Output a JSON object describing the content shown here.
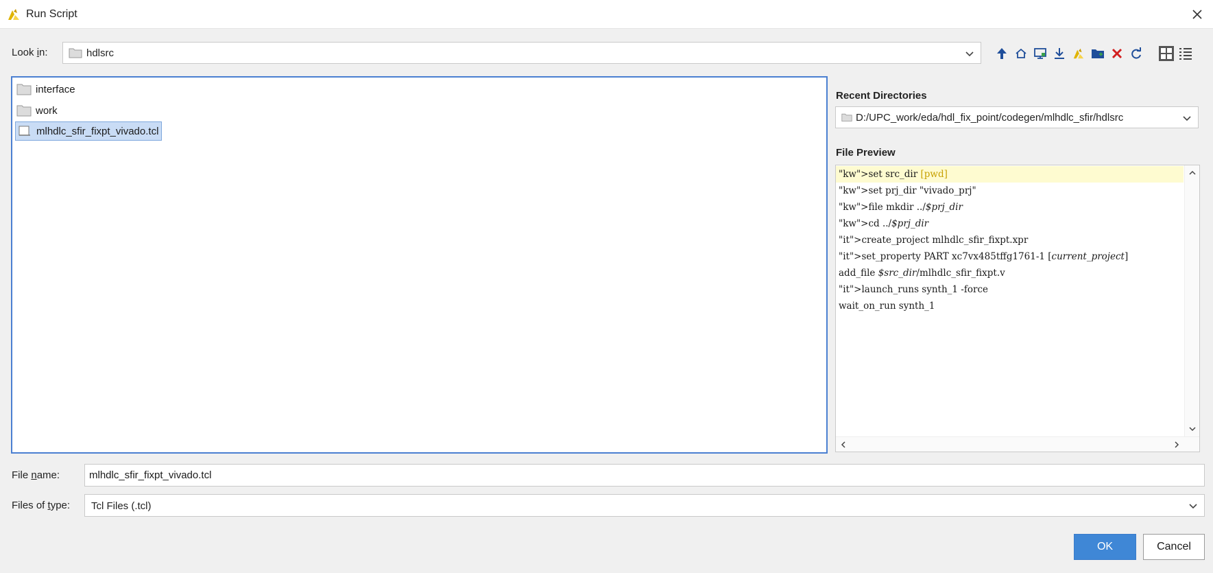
{
  "window": {
    "title": "Run Script"
  },
  "look_in": {
    "label_pre": "Look ",
    "label_mnemonic": "i",
    "label_post": "n:",
    "value": "hdlsrc"
  },
  "toolbar": {
    "icons": [
      "arrow-up-icon",
      "home-icon",
      "desktop-icon",
      "download-icon",
      "vivado-project-icon",
      "new-folder-icon",
      "delete-icon",
      "refresh-icon",
      "grid-view-icon",
      "list-view-icon"
    ]
  },
  "files": [
    {
      "name": "interface",
      "type": "folder"
    },
    {
      "name": "work",
      "type": "folder"
    },
    {
      "name": "mlhdlc_sfir_fixpt_vivado.tcl",
      "type": "file",
      "selected": true
    }
  ],
  "recent_directories": {
    "title": "Recent Directories",
    "value": "D:/UPC_work/eda/hdl_fix_point/codegen/mlhdlc_sfir/hdlsrc"
  },
  "file_preview": {
    "title": "File Preview",
    "lines": [
      "set src_dir [pwd]",
      "set prj_dir \"vivado_prj\"",
      "file mkdir ../$prj_dir",
      "cd ../$prj_dir",
      "create_project mlhdlc_sfir_fixpt.xpr",
      "set_property PART xc7vx485tffg1761-1 [current_project]",
      "add_file $src_dir/mlhdlc_sfir_fixpt.v",
      "launch_runs synth_1 -force",
      "wait_on_run synth_1"
    ]
  },
  "file_name": {
    "label_pre": "File ",
    "label_mnemonic": "n",
    "label_post": "ame:",
    "value": "mlhdlc_sfir_fixpt_vivado.tcl"
  },
  "files_of_type": {
    "label_pre": "Files of ",
    "label_mnemonic": "t",
    "label_post": "ype:",
    "value": "Tcl Files (.tcl)"
  },
  "buttons": {
    "ok": "OK",
    "cancel": "Cancel"
  },
  "colors": {
    "accent": "#3f87d6",
    "selection": "#c9dcf5",
    "keyword": "#d12cc8",
    "highlight_line": "#fefbd0"
  }
}
